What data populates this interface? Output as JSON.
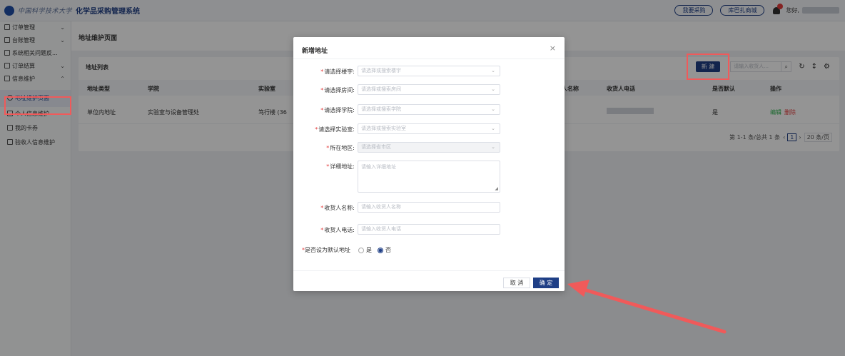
{
  "header": {
    "brand_script": "中国科学技术大学",
    "app_title": "化学品采购管理系统",
    "btn_my_purchase": "我要采购",
    "btn_store": "库巴扎商城",
    "greeting": "您好,"
  },
  "sidebar": {
    "items": [
      {
        "label": "订单管理"
      },
      {
        "label": "台账管理"
      },
      {
        "label": "系统相关问题反..."
      },
      {
        "label": "订单结算"
      },
      {
        "label": "信息维护"
      },
      {
        "label": "地址维护页面"
      },
      {
        "label": "个人信息维护"
      },
      {
        "label": "我的卡券"
      },
      {
        "label": "验收人信息维护"
      }
    ]
  },
  "page": {
    "title": "地址维护页面",
    "list_title": "地址列表",
    "new_btn": "新 建",
    "search_placeholder": "请输入收货人...",
    "columns": [
      "地址类型",
      "学院",
      "实验室",
      "人名称",
      "收货人电话",
      "是否默认",
      "操作"
    ],
    "rows": [
      {
        "type": "单位内地址",
        "college": "实验室与设备管理处",
        "lab": "笃行楼 (36",
        "default": "是",
        "edit": "编辑",
        "delete": "删除"
      }
    ],
    "pagination": {
      "summary": "第 1-1 条/总共 1 条",
      "current": "1",
      "page_size": "20 条/页"
    }
  },
  "dialog": {
    "title": "新增地址",
    "fields": [
      {
        "label": "请选择楼宇:",
        "placeholder": "请选择或搜索楼宇"
      },
      {
        "label": "请选择房间:",
        "placeholder": "请选择或搜索房间"
      },
      {
        "label": "请选择学院:",
        "placeholder": "请选择或搜索学院"
      },
      {
        "label": "请选择实验室:",
        "placeholder": "请选择或搜索实验室"
      },
      {
        "label": "所在地区:",
        "placeholder": "请选择省市区"
      },
      {
        "label": "详细地址:",
        "placeholder": "请输入详细地址"
      },
      {
        "label": "收货人名称:",
        "placeholder": "请输入收货人名称"
      },
      {
        "label": "收货人电话:",
        "placeholder": "请输入收货人电话"
      }
    ],
    "default_label": "是否设为默认地址",
    "radio_yes": "是",
    "radio_no": "否",
    "cancel": "取 消",
    "ok": "确 定"
  },
  "colors": {
    "primary": "#1f3f86",
    "highlight": "#f05a5a",
    "success": "#2bb24c",
    "danger": "#e43c3c"
  }
}
